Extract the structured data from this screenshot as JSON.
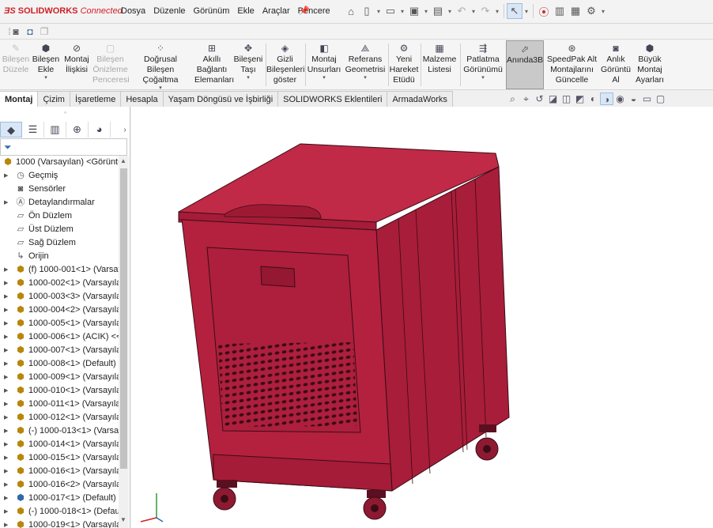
{
  "app": {
    "logo_prefix": "SOLID",
    "logo_bold": "WORKS",
    "logo_suffix": "Connected"
  },
  "menu": [
    "Dosya",
    "Düzenle",
    "Görünüm",
    "Ekle",
    "Araçlar",
    "Pencere"
  ],
  "command_manager": [
    {
      "label": "Bileşen\nDüzele",
      "disabled": true
    },
    {
      "label": "Bileşen\nEkle",
      "disabled": false,
      "arrow": true
    },
    {
      "label": "Montaj\nİlişkisi",
      "disabled": false
    },
    {
      "label": "Bileşen\nÖnizleme\nPenceresi",
      "disabled": true
    },
    {
      "label": "Doğrusal Bileşen\nÇoğaltma",
      "disabled": false,
      "arrow": true
    },
    {
      "label": "Akıllı\nBağlantı\nElemanları",
      "disabled": false
    },
    {
      "label": "Bileşeni\nTaşı",
      "disabled": false,
      "arrow": true
    },
    {
      "label": "Gizli\nBileşenleri\ngöster",
      "disabled": false
    },
    {
      "label": "Montaj\nUnsurları",
      "disabled": false,
      "arrow": true
    },
    {
      "label": "Referans\nGeometrisi",
      "disabled": false,
      "arrow": true
    },
    {
      "label": "Yeni\nHareket\nEtüdü",
      "disabled": false
    },
    {
      "label": "Malzeme\nListesi",
      "disabled": false
    },
    {
      "label": "Patlatma\nGörünümü",
      "disabled": false,
      "arrow": true
    },
    {
      "label": "Anında3B",
      "disabled": false,
      "active": true
    },
    {
      "label": "SpeedPak Alt\nMontajlarını\nGüncelle",
      "disabled": false
    },
    {
      "label": "Anlık\nGörüntü\nAl",
      "disabled": false
    },
    {
      "label": "Büyük\nMontaj\nAyarları",
      "disabled": false
    }
  ],
  "tabs": [
    "Montaj",
    "Çizim",
    "İşaretleme",
    "Hesapla",
    "Yaşam Döngüsü ve İşbirliği",
    "SOLIDWORKS Eklentileri",
    "ArmadaWorks"
  ],
  "active_tab": "Montaj",
  "tree": {
    "root": "1000 (Varsayılan) <Görüntü",
    "items": [
      {
        "text": "Geçmiş",
        "icon": "history-icon",
        "expandable": true
      },
      {
        "text": "Sensörler",
        "icon": "sensor-icon",
        "expandable": false
      },
      {
        "text": "Detaylandırmalar",
        "icon": "annotation-icon",
        "expandable": true
      },
      {
        "text": "Ön Düzlem",
        "icon": "plane-icon",
        "expandable": false
      },
      {
        "text": "Üst Düzlem",
        "icon": "plane-icon",
        "expandable": false
      },
      {
        "text": "Sağ Düzlem",
        "icon": "plane-icon",
        "expandable": false
      },
      {
        "text": "Orijin",
        "icon": "origin-icon",
        "expandable": false
      },
      {
        "text": "(f) 1000-001<1> (Varsay",
        "icon": "part-icon",
        "expandable": true
      },
      {
        "text": "1000-002<1> (Varsayıla",
        "icon": "part-icon",
        "expandable": true
      },
      {
        "text": "1000-003<3> (Varsayıla",
        "icon": "part-icon",
        "expandable": true
      },
      {
        "text": "1000-004<2> (Varsayıla",
        "icon": "part-icon",
        "expandable": true
      },
      {
        "text": "1000-005<1> (Varsayıla",
        "icon": "part-icon",
        "expandable": true
      },
      {
        "text": "1000-006<1> (ACIK) <<",
        "icon": "part-icon",
        "expandable": true
      },
      {
        "text": "1000-007<1> (Varsayıla",
        "icon": "part-icon",
        "expandable": true
      },
      {
        "text": "1000-008<1> (Default)",
        "icon": "part-icon",
        "expandable": true
      },
      {
        "text": "1000-009<1> (Varsayıla",
        "icon": "part-icon",
        "expandable": true
      },
      {
        "text": "1000-010<1> (Varsayıla",
        "icon": "part-icon",
        "expandable": true
      },
      {
        "text": "1000-011<1> (Varsayıla",
        "icon": "part-icon",
        "expandable": true
      },
      {
        "text": "1000-012<1> (Varsayıla",
        "icon": "part-icon",
        "expandable": true
      },
      {
        "text": "(-) 1000-013<1> (Varsay",
        "icon": "part-icon",
        "expandable": true
      },
      {
        "text": "1000-014<1> (Varsayıla",
        "icon": "part-icon",
        "expandable": true
      },
      {
        "text": "1000-015<1> (Varsayıla",
        "icon": "part-icon",
        "expandable": true
      },
      {
        "text": "1000-016<1> (Varsayıla",
        "icon": "part-icon",
        "expandable": true
      },
      {
        "text": "1000-016<2> (Varsayıla",
        "icon": "part-icon",
        "expandable": true
      },
      {
        "text": "1000-017<1> (Default)",
        "icon": "assembly-icon",
        "expandable": true
      },
      {
        "text": "(-) 1000-018<1> (Defau",
        "icon": "part-icon",
        "expandable": true
      },
      {
        "text": "1000-019<1> (Varsayıla",
        "icon": "part-icon",
        "expandable": true
      }
    ]
  },
  "colors": {
    "model_body": "#b3213f",
    "model_top": "#bf2744",
    "model_edge": "#3a0c16",
    "accent": "#d12027"
  }
}
